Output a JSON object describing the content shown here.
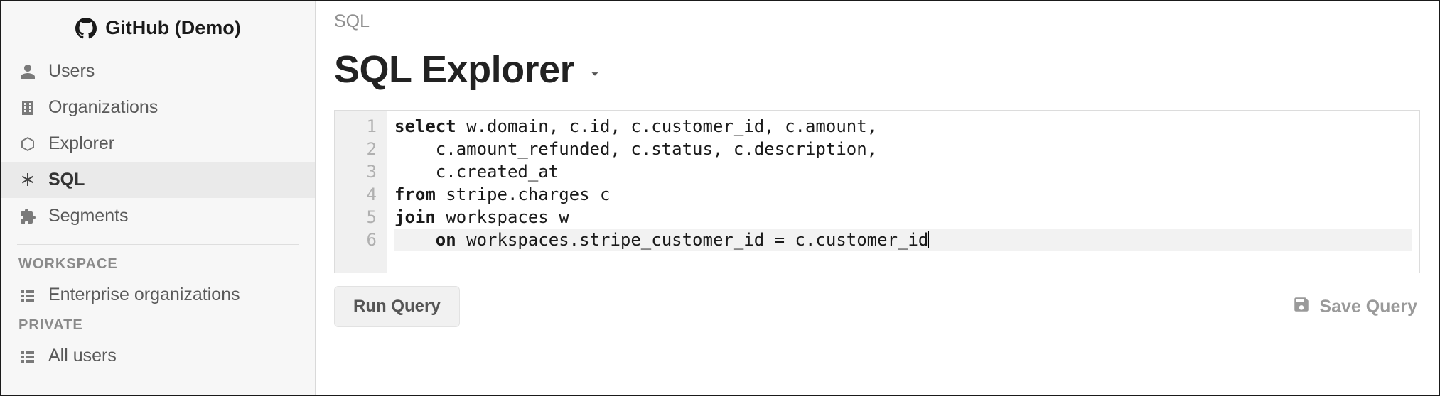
{
  "sidebar": {
    "logo_label": "GitHub (Demo)",
    "items": [
      {
        "icon": "user-icon",
        "label": "Users",
        "active": false
      },
      {
        "icon": "building-icon",
        "label": "Organizations",
        "active": false
      },
      {
        "icon": "cube-icon",
        "label": "Explorer",
        "active": false
      },
      {
        "icon": "asterisk-icon",
        "label": "SQL",
        "active": true
      },
      {
        "icon": "puzzle-icon",
        "label": "Segments",
        "active": false
      }
    ],
    "sections": [
      {
        "label": "WORKSPACE",
        "items": [
          {
            "icon": "list-icon",
            "label": "Enterprise organizations"
          }
        ]
      },
      {
        "label": "PRIVATE",
        "items": [
          {
            "icon": "list-icon",
            "label": "All users"
          }
        ]
      }
    ]
  },
  "breadcrumb": "SQL",
  "page_title": "SQL Explorer",
  "editor": {
    "lines": [
      {
        "n": 1,
        "tokens": [
          {
            "t": "select ",
            "kw": true
          },
          {
            "t": "w.domain, c.id, c.customer_id, c.amount,"
          }
        ]
      },
      {
        "n": 2,
        "tokens": [
          {
            "t": "    c.amount_refunded, c.status, c.description,"
          }
        ]
      },
      {
        "n": 3,
        "tokens": [
          {
            "t": "    c.created_at"
          }
        ]
      },
      {
        "n": 4,
        "tokens": [
          {
            "t": "from ",
            "kw": true
          },
          {
            "t": "stripe.charges c"
          }
        ]
      },
      {
        "n": 5,
        "tokens": [
          {
            "t": "join ",
            "kw": true
          },
          {
            "t": "workspaces w"
          }
        ]
      },
      {
        "n": 6,
        "tokens": [
          {
            "t": "    "
          },
          {
            "t": "on ",
            "kw": true
          },
          {
            "t": "workspaces.stripe_customer_id = c.customer_id"
          }
        ],
        "current": true,
        "caret": true
      }
    ]
  },
  "actions": {
    "run_label": "Run Query",
    "save_label": "Save Query"
  }
}
